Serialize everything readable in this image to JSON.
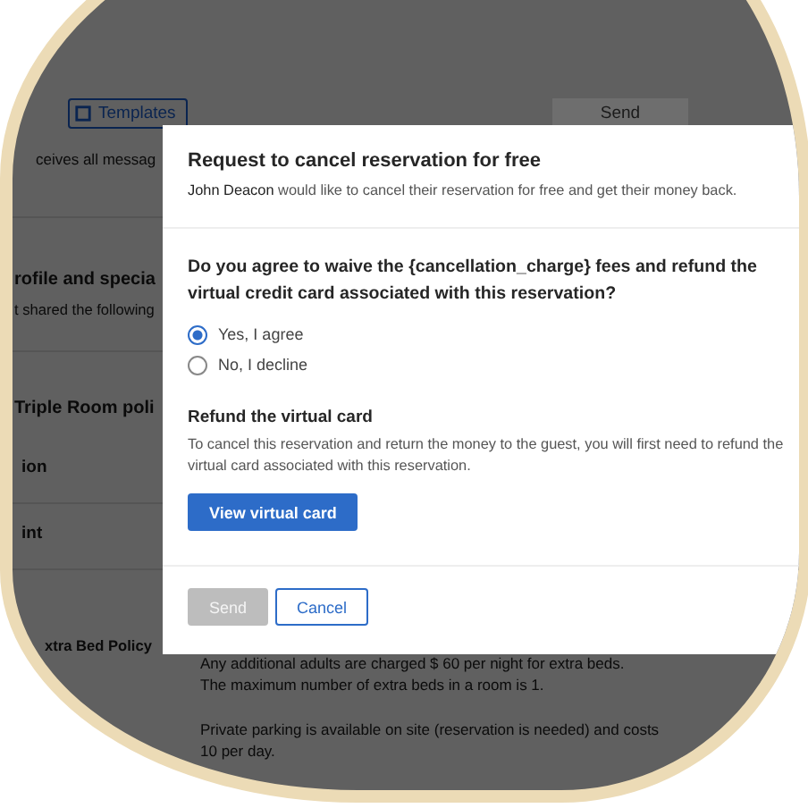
{
  "page": {
    "templates_button": "Templates",
    "send_button": "Send",
    "notice": "ceives all messag",
    "profile_heading": "rofile and specia",
    "profile_text": "t shared the following",
    "policy_heading": "Triple Room poli",
    "policy_rows": [
      "ion",
      "int"
    ],
    "extra_bed": {
      "label": "xtra Bed Policy",
      "lines": [
        "Any additional adults are charged $ 60 per night for extra beds.",
        "The maximum number of extra beds in a room is 1."
      ]
    },
    "parking": [
      "Private parking is available on site (reservation is needed) and costs",
      "10 per day."
    ]
  },
  "modal": {
    "title": "Request to cancel reservation for free",
    "subtitle": "**John Deacon** would like to cancel their reservation for free and get their money back.",
    "question": "Do you agree to waive the {cancellation_charge} fees and refund the virtual credit card associated with this reservation?",
    "options": [
      {
        "label": "Yes, I agree",
        "selected": true
      },
      {
        "label": "No, I decline",
        "selected": false
      }
    ],
    "refund_heading": "Refund the virtual card",
    "refund_text": "To cancel this reservation and return the money to the guest, you will first need to refund the virtual card associated with this reservation.",
    "view_button": "View virtual card",
    "footer_buttons": [
      {
        "label": "Send",
        "kind": "primary",
        "disabled": true
      },
      {
        "label": "Cancel",
        "kind": "secondary",
        "disabled": false
      }
    ]
  }
}
